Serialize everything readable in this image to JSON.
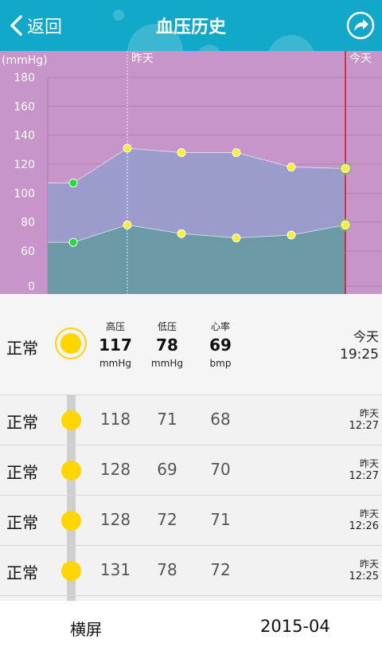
{
  "header": {
    "back_label": "返回",
    "title": "血压历史",
    "colors": {
      "bar": "#12a8c9"
    }
  },
  "chart_data": {
    "type": "area",
    "ylabel": "(mmHg)",
    "ylim": [
      0,
      180
    ],
    "yticks": [
      "0",
      "60",
      "80",
      "100",
      "120",
      "140",
      "160",
      "180"
    ],
    "markers": [
      {
        "label": "昨天",
        "x_index": 1
      },
      {
        "label": "今天",
        "x_index": 6
      }
    ],
    "series": [
      {
        "values": [
          107,
          131,
          128,
          128,
          118,
          117
        ]
      },
      {
        "values": [
          66,
          78,
          72,
          69,
          71,
          78
        ]
      }
    ],
    "colors": {
      "background": "#c795c9",
      "upper_fill": "#9b9ccb",
      "lower_fill": "#6b9aa6",
      "point": "#ffee33",
      "first_point": "#22dd33",
      "today_line": "#dd1111"
    }
  },
  "list": {
    "columns": {
      "sys": "高压",
      "dia": "低压",
      "hr": "心率"
    },
    "units": {
      "sys": "mmHg",
      "dia": "mmHg",
      "hr": "bmp"
    },
    "rows": [
      {
        "status": "正常",
        "sys": "117",
        "dia": "78",
        "hr": "69",
        "day": "今天",
        "time": "19:25"
      },
      {
        "status": "正常",
        "sys": "118",
        "dia": "71",
        "hr": "68",
        "day": "昨天",
        "time": "12:27"
      },
      {
        "status": "正常",
        "sys": "128",
        "dia": "69",
        "hr": "70",
        "day": "昨天",
        "time": "12:27"
      },
      {
        "status": "正常",
        "sys": "128",
        "dia": "72",
        "hr": "71",
        "day": "昨天",
        "time": "12:26"
      },
      {
        "status": "正常",
        "sys": "131",
        "dia": "78",
        "hr": "72",
        "day": "昨天",
        "time": "12:25"
      }
    ]
  },
  "footer": {
    "landscape_label": "横屏",
    "month": "2015-04"
  },
  "icons": {
    "back": "chevron-left-icon",
    "share": "share-icon"
  }
}
